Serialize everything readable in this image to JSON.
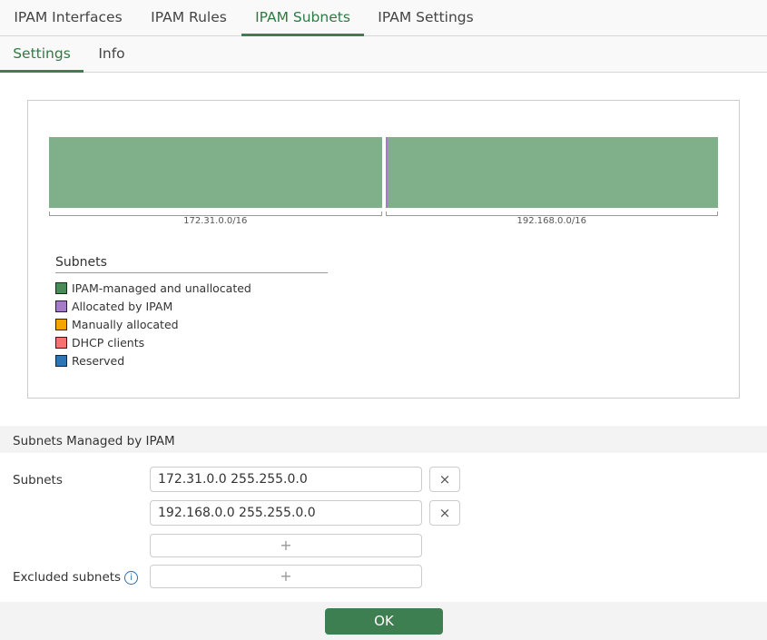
{
  "tabs": [
    {
      "label": "IPAM Interfaces"
    },
    {
      "label": "IPAM Rules"
    },
    {
      "label": "IPAM Subnets",
      "active": true
    },
    {
      "label": "IPAM Settings"
    }
  ],
  "subtabs": [
    {
      "label": "Settings",
      "active": true
    },
    {
      "label": "Info"
    }
  ],
  "chart_data": {
    "type": "bar",
    "categories": [
      "172.31.0.0/16",
      "192.168.0.0/16"
    ],
    "series": [
      {
        "name": "Allocated by IPAM",
        "values": [
          0,
          0.005
        ]
      },
      {
        "name": "IPAM-managed and unallocated",
        "values": [
          1,
          0.995
        ]
      }
    ],
    "legend_title": "Subnets",
    "legend": [
      {
        "label": "IPAM-managed and unallocated",
        "color": "#4a8a57"
      },
      {
        "label": "Allocated by IPAM",
        "color": "#a679c9"
      },
      {
        "label": "Manually allocated",
        "color": "#f5a500"
      },
      {
        "label": "DHCP clients",
        "color": "#f47272"
      },
      {
        "label": "Reserved",
        "color": "#2f75b5"
      }
    ]
  },
  "section_title": "Subnets Managed by IPAM",
  "form": {
    "subnets_label": "Subnets",
    "subnets": [
      "172.31.0.0 255.255.0.0",
      "192.168.0.0 255.255.0.0"
    ],
    "remove_icon": "×",
    "add_icon": "+",
    "excluded_label": "Excluded subnets",
    "info_icon": "i"
  },
  "ok_label": "OK"
}
